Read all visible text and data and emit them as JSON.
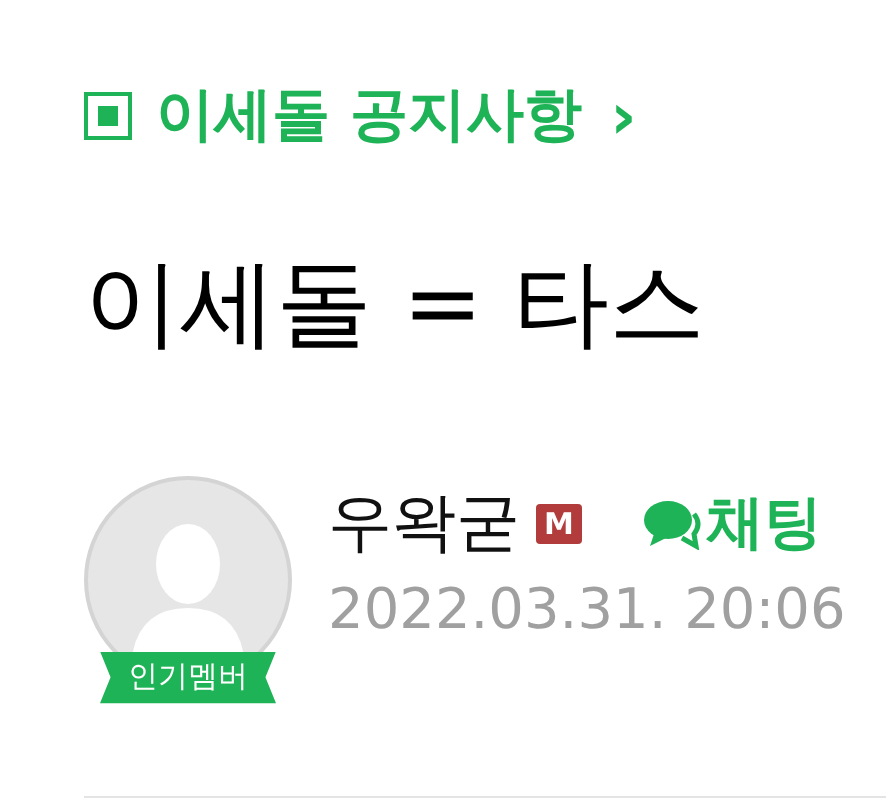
{
  "board_link": {
    "label": "이세돌 공지사항",
    "arrow": "›"
  },
  "title": "이세돌 = 타스",
  "author": {
    "name": "우왁굳",
    "manager_badge": "M",
    "member_badge": "인기멤버",
    "chat_label": "채팅",
    "date": "2022.03.31. 20:06"
  }
}
